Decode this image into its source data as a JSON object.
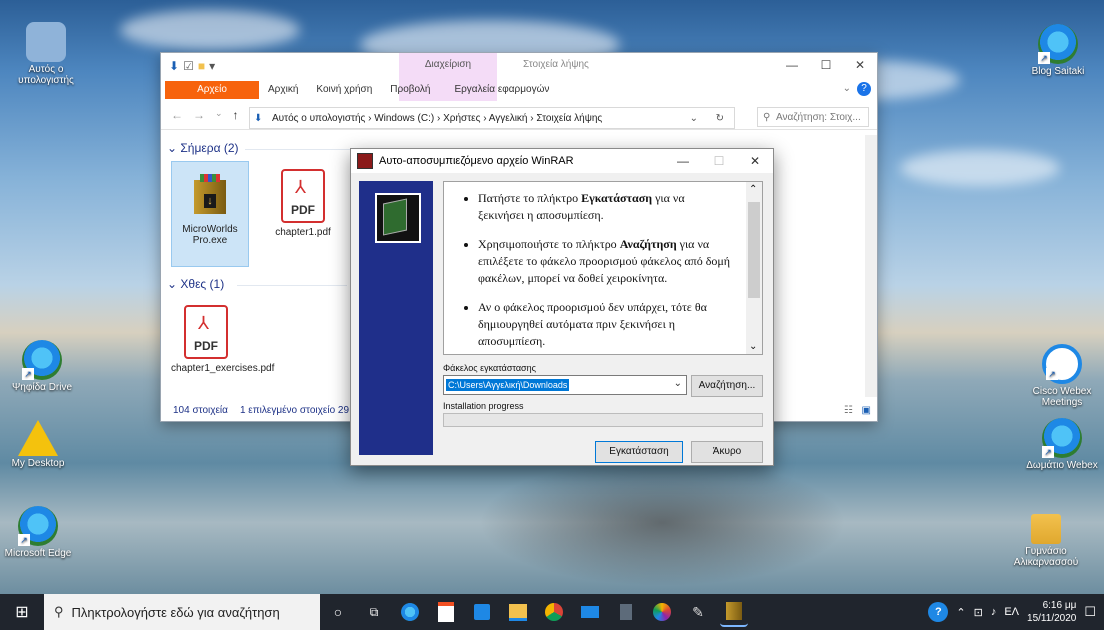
{
  "desktop": {
    "icons": [
      {
        "label": "Αυτός ο υπολογιστής"
      },
      {
        "label": "Ψηφίδα Drive"
      },
      {
        "label": "My Desktop"
      },
      {
        "label": "Microsoft Edge"
      },
      {
        "label": "Blog Saitaki"
      },
      {
        "label": "Cisco Webex Meetings"
      },
      {
        "label": "Δωμάτιο Webex"
      },
      {
        "label": "Γυμνάσιο Αλικαρνασσού"
      }
    ]
  },
  "explorer": {
    "context_tab_title": "Διαχείριση",
    "window_title": "Στοιχεία λήψης",
    "ribbon_tabs": [
      "Αρχείο",
      "Αρχική",
      "Κοινή χρήση",
      "Προβολή",
      "Εργαλεία εφαρμογών"
    ],
    "breadcrumbs": "Αυτός ο υπολογιστής  ›  Windows (C:)  ›  Χρήστες  ›  Αγγελική  ›  Στοιχεία λήψης",
    "search_placeholder": "Αναζήτηση: Στοιχ...",
    "groups": [
      {
        "header": "Σήμερα (2)"
      },
      {
        "header": "Χθες (1)"
      }
    ],
    "files": [
      {
        "name": "MicroWorlds Pro.exe",
        "pdf_label": ""
      },
      {
        "name": "chapter1.pdf",
        "pdf_label": "PDF"
      },
      {
        "name": "chapter1_exercises.pdf",
        "pdf_label": "PDF"
      }
    ],
    "status_count": "104 στοιχεία",
    "status_selected": "1 επιλεγμένο στοιχείο  29"
  },
  "winrar": {
    "title": "Αυτο-αποσυμπιεζόμενο αρχείο WinRAR",
    "instructions": [
      {
        "pre": "Πατήστε το πλήκτρο ",
        "bold": "Εγκατάσταση",
        "post": " για να ξεκινήσει η αποσυμπίεση."
      },
      {
        "pre": "Χρησιμοποιήστε το πλήκτρο ",
        "bold": "Αναζήτηση",
        "post": " για να επιλέξετε το φάκελο προορισμού φάκελος από δομή φακέλων, μπορεί να δοθεί χειροκίνητα."
      },
      {
        "pre": "Αν ο φάκελος προορισμού δεν υπάρχει, τότε θα δημιουργηθεί αυτόματα πριν ξεκινήσει η αποσυμπίεση.",
        "bold": "",
        "post": ""
      }
    ],
    "dest_label": "Φάκελος εγκατάστασης",
    "dest_value": "C:\\Users\\Αγγελική\\Downloads",
    "browse_label": "Αναζήτηση...",
    "progress_label": "Installation progress",
    "progress_value": 0,
    "install_label": "Εγκατάσταση",
    "cancel_label": "Άκυρο"
  },
  "taskbar": {
    "search_placeholder": "Πληκτρολογήστε εδώ για αναζήτηση",
    "language": "ΕΛ",
    "time": "6:16 μμ",
    "date": "15/11/2020"
  }
}
